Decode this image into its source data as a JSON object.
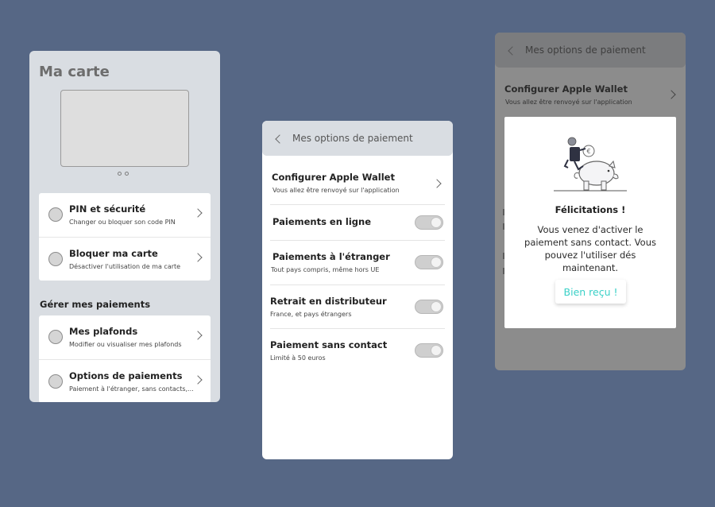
{
  "screen1": {
    "title": "Ma carte",
    "card_items": [
      {
        "label": "PIN et sécurité",
        "subtitle": "Changer ou bloquer son code PIN"
      },
      {
        "label": "Bloquer ma carte",
        "subtitle": "Désactiver l'utilisation de ma carte"
      }
    ],
    "section_title": "Gérer mes paiements",
    "payment_items": [
      {
        "label": "Mes plafonds",
        "subtitle": "Modifier ou visualiser mes plafonds"
      },
      {
        "label": "Options de paiements",
        "subtitle": "Paiement à l'étranger, sans contacts,..."
      }
    ]
  },
  "screen2": {
    "header_title": "Mes options de paiement",
    "apple_wallet": {
      "label": "Configurer Apple Wallet",
      "subtitle": "Vous allez être renvoyé sur l'application"
    },
    "options": [
      {
        "label": "Paiements en ligne",
        "subtitle": "",
        "enabled": false
      },
      {
        "label": "Paiements à l'étranger",
        "subtitle": "Tout pays compris, même hors UE",
        "enabled": false
      },
      {
        "label": "Retrait en distributeur",
        "subtitle": "France, et pays étrangers",
        "enabled": false
      },
      {
        "label": "Paiement sans contact",
        "subtitle": "Limité à 50 euros",
        "enabled": false
      }
    ]
  },
  "screen3": {
    "header_title": "Mes options de paiement",
    "apple_wallet": {
      "label": "Configurer Apple Wallet",
      "subtitle": "Vous allez être renvoyé sur l'application"
    },
    "modal": {
      "title": "Félicitations !",
      "message": "Vous venez d'activer le paiement sans contact. Vous pouvez l'utiliser dés maintenant.",
      "button_label": "Bien reçu !"
    }
  },
  "colors": {
    "background": "#566785",
    "panel": "#d9dde2",
    "accent": "#3ad0c7",
    "overlay": "#8c8c8c"
  }
}
